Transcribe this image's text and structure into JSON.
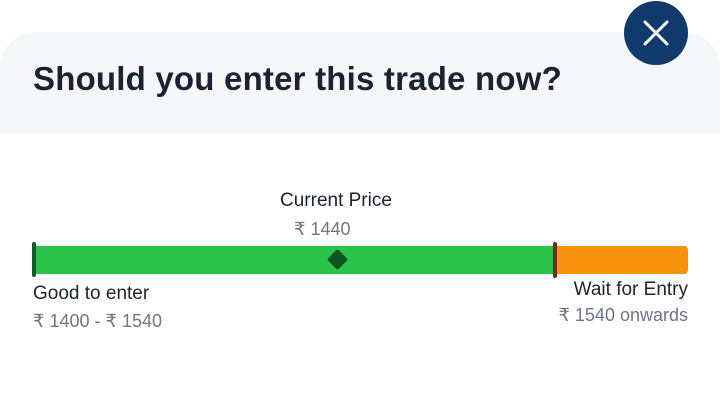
{
  "header": {
    "title": "Should you enter this trade now?",
    "close_icon": "close-icon"
  },
  "indicator": {
    "current_label": "Current Price",
    "current_value": "₹ 1440",
    "good_label": "Good to enter",
    "good_range": "₹ 1400 - ₹ 1540",
    "wait_label": "Wait for Entry",
    "wait_range": "₹ 1540 onwards"
  },
  "colors": {
    "good_zone": "#2bc44a",
    "wait_zone": "#f7920e",
    "marker": "#0d5520",
    "close_button": "#0f3a6b"
  }
}
